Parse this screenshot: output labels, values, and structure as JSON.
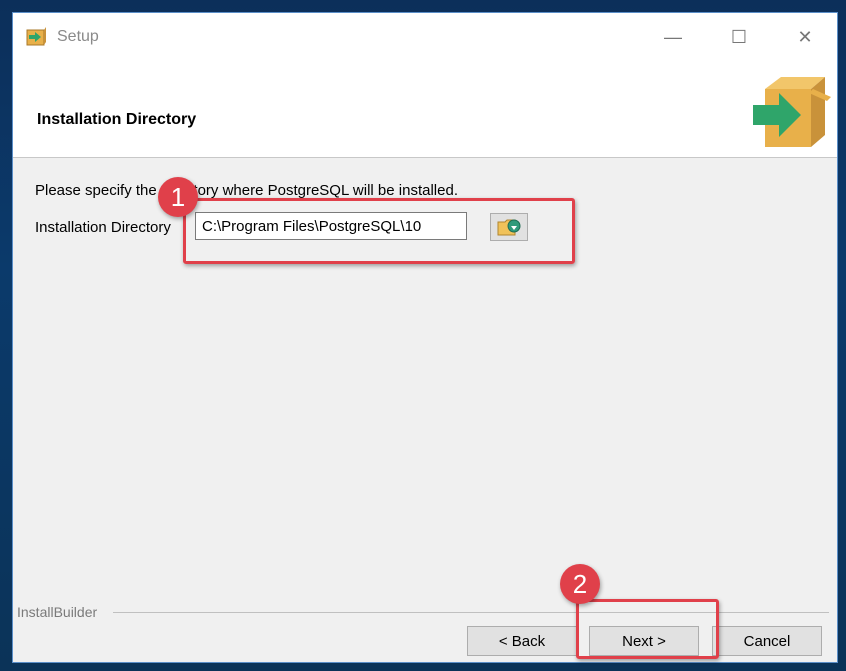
{
  "window": {
    "title": "Setup",
    "controls": {
      "minimize": "—",
      "maximize": "☐",
      "close": "✕"
    }
  },
  "header": {
    "title": "Installation Directory"
  },
  "body": {
    "prompt": "Please specify the directory where PostgreSQL will be installed.",
    "dir_label": "Installation Directory",
    "dir_value": "C:\\Program Files\\PostgreSQL\\10"
  },
  "annotations": {
    "step1": "1",
    "step2": "2",
    "accent_color": "#e0404a"
  },
  "footer": {
    "brand": "InstallBuilder",
    "back_label": "< Back",
    "next_label": "Next >",
    "cancel_label": "Cancel"
  },
  "icons": {
    "app": "setup-box-arrow-icon",
    "header_logo": "package-arrow-icon",
    "browse": "folder-browse-icon"
  }
}
